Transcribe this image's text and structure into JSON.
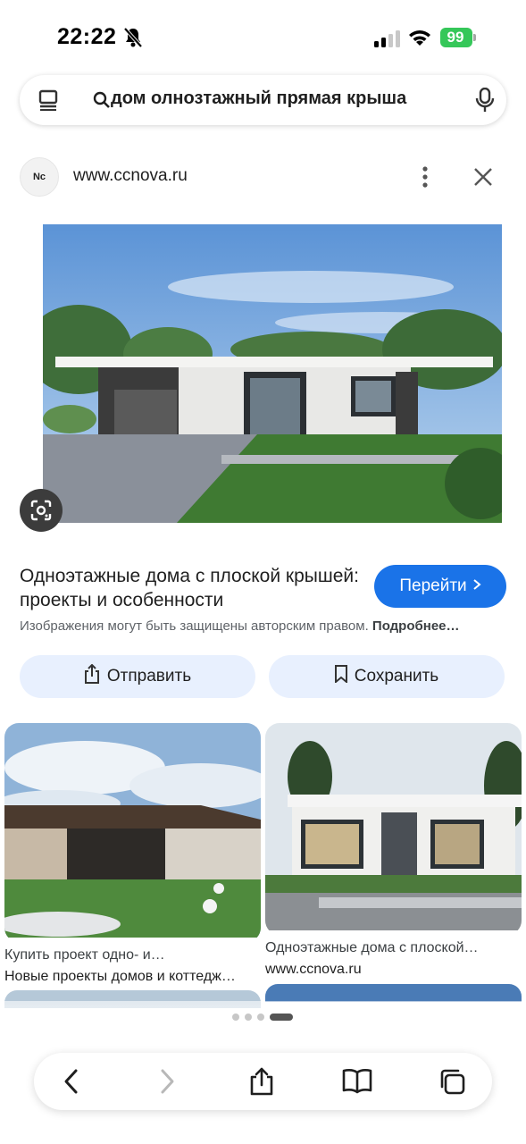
{
  "status_bar": {
    "time": "22:22",
    "battery": "99",
    "icons": [
      "bell-slash-icon",
      "cellular-signal-icon",
      "wifi-icon",
      "battery-charging-icon"
    ]
  },
  "search": {
    "query": "дом олнозтажный прямая крыша",
    "icons": [
      "tabs-icon",
      "search-icon",
      "microphone-icon"
    ]
  },
  "source": {
    "logo_text": "Nc",
    "url": "www.ccnova.ru",
    "icons": [
      "more-vert-icon",
      "close-icon"
    ]
  },
  "result": {
    "title": "Одноэтажные дома с плоской крышей: проекты и особенности",
    "go_label": "Перейти",
    "copyright_text": "Изображения могут быть защищены авторским правом.",
    "copyright_link": "Подробнее…",
    "share_label": "Отправить",
    "save_label": "Сохранить"
  },
  "related": [
    {
      "caption": "Купить проект одно- и…",
      "source": "Новые проекты домов и коттедж…"
    },
    {
      "caption": "Одноэтажные дома с плоской…",
      "source": "www.ccnova.ru"
    }
  ],
  "pagination": {
    "pages": 4,
    "active": 4
  },
  "toolbar": {
    "icons": [
      "back-icon",
      "forward-icon",
      "share-icon",
      "bookmarks-icon",
      "tabs-overview-icon"
    ]
  },
  "colors": {
    "accent": "#1a73e8",
    "action_bg": "#e8f0fe",
    "battery": "#35c759"
  }
}
